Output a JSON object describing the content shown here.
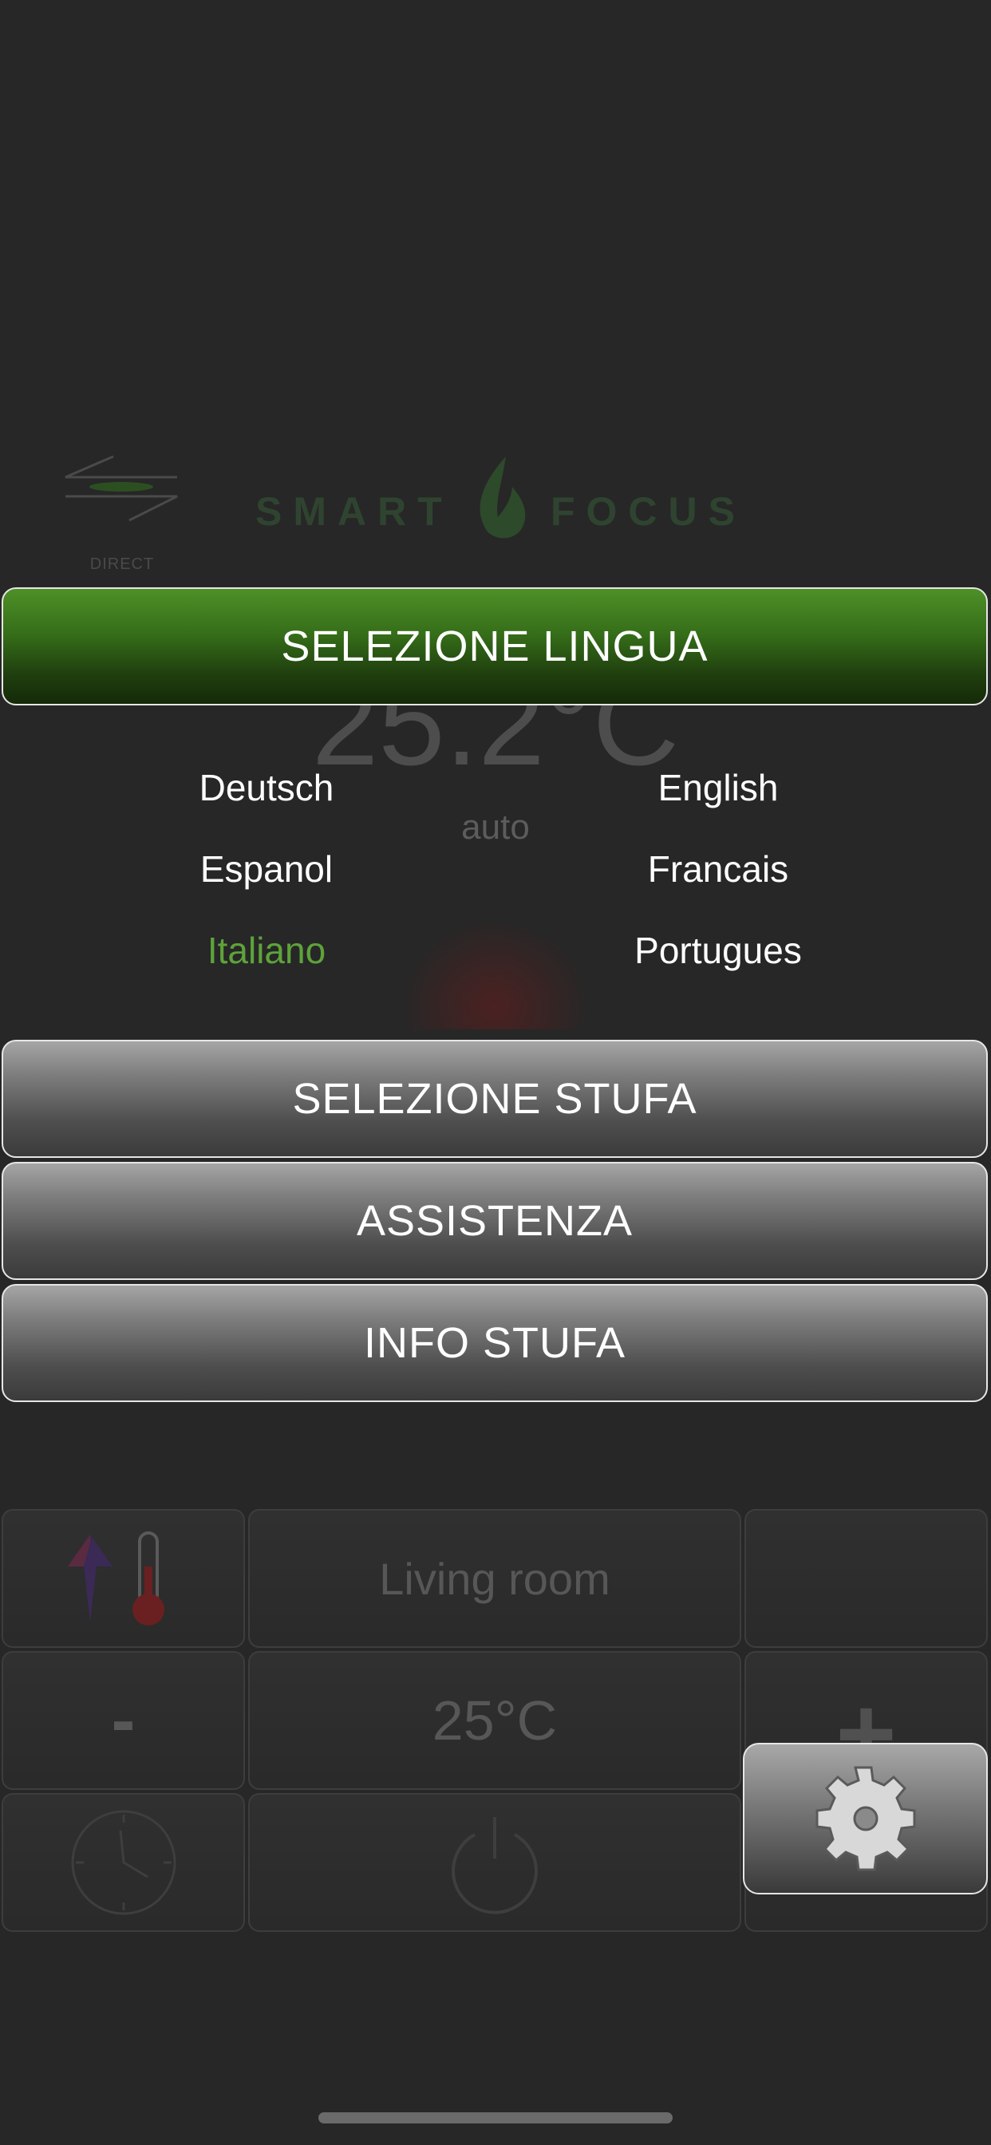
{
  "background": {
    "direct_label": "DIRECT",
    "brand_left": "SMART",
    "brand_right": "FOCUS",
    "current_temperature": "25.2°C",
    "mode": "auto"
  },
  "menu": {
    "language_header": "SELEZIONE LINGUA",
    "languages": [
      {
        "label": "Deutsch",
        "selected": false
      },
      {
        "label": "English",
        "selected": false
      },
      {
        "label": "Espanol",
        "selected": false
      },
      {
        "label": "Francais",
        "selected": false
      },
      {
        "label": "Italiano",
        "selected": true
      },
      {
        "label": "Portugues",
        "selected": false
      }
    ],
    "stove_select": "SELEZIONE STUFA",
    "assistance": "ASSISTENZA",
    "stove_info": "INFO STUFA"
  },
  "controls": {
    "room_name": "Living room",
    "decrease_label": "-",
    "target_temperature": "25°C",
    "increase_label": "+"
  },
  "colors": {
    "accent_green": "#4e9027",
    "selected_language": "#5ea33a",
    "background": "#272727"
  },
  "icons": {
    "direct": "direct-arrows-icon",
    "brand": "flame-leaf-icon",
    "thermostat": "thermometer-arrow-icon",
    "timer": "clock-icon",
    "power": "power-icon",
    "settings": "gear-icon"
  }
}
